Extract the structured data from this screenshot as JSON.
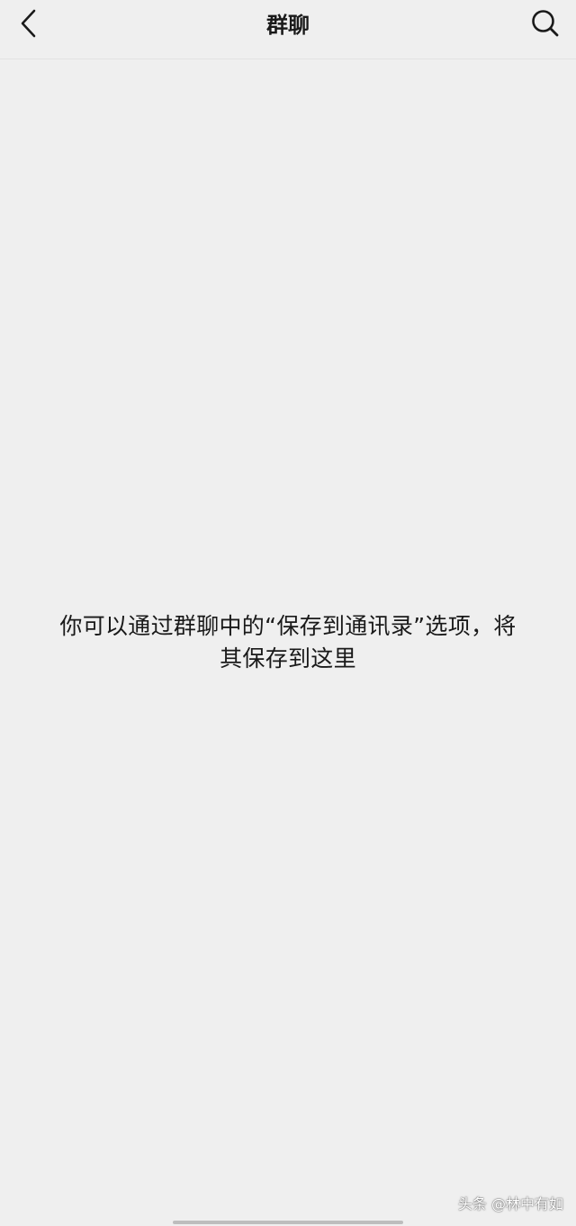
{
  "navbar": {
    "title": "群聊",
    "back_icon": "chevron-left-icon",
    "search_icon": "search-icon"
  },
  "main": {
    "empty_hint_line1": "你可以通过群聊中的“保存到通讯录”选项，将",
    "empty_hint_line2": "其保存到这里"
  },
  "watermark": {
    "text": "头条 @林中有如"
  }
}
